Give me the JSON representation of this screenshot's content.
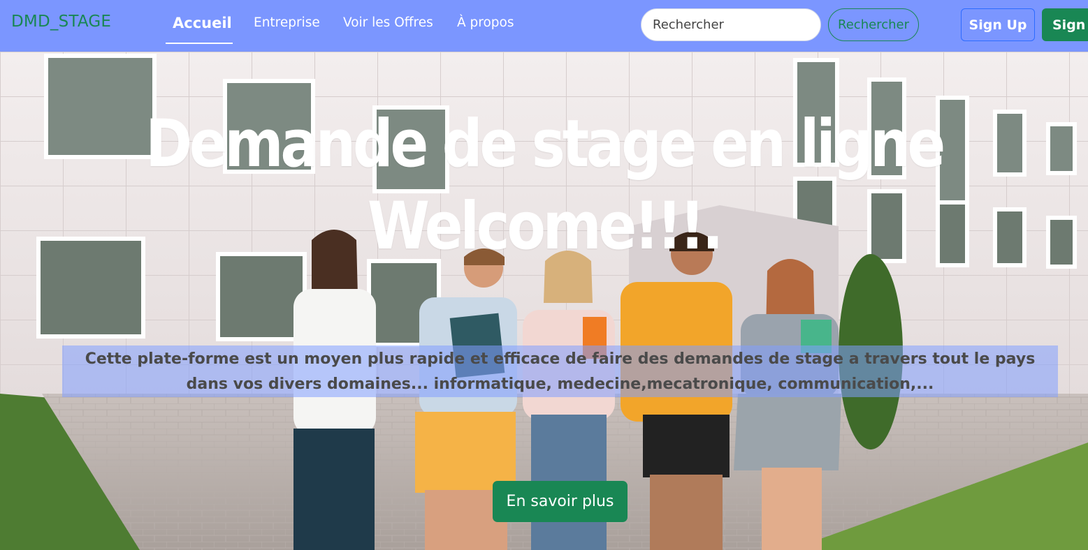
{
  "navbar": {
    "brand": "DMD_STAGE",
    "links": [
      {
        "label": "Accueil",
        "active": true
      },
      {
        "label": "Entreprise"
      },
      {
        "label": "Voir les Offres"
      },
      {
        "label": "À propos"
      }
    ],
    "search": {
      "placeholder": "Rechercher",
      "button_label": "Rechercher"
    },
    "signup_label": "Sign Up",
    "signin_label": "Sign In"
  },
  "hero": {
    "title_line1": "Demande de stage en ligne",
    "title_line2": "Welcome!!!.",
    "description": "Cette plate-forme est un moyen plus rapide et efficace de faire des demandes de stage a travers tout le pays dans vos divers domaines... informatique, medecine,mecatronique, communication,...",
    "cta_label": "En savoir plus",
    "image_icon": "photo-students-campus"
  },
  "colors": {
    "navbar_bg": "#7b96ff",
    "brand_green": "#198754",
    "signup_border": "#2d6bff",
    "banner_overlay": "#829eff"
  }
}
